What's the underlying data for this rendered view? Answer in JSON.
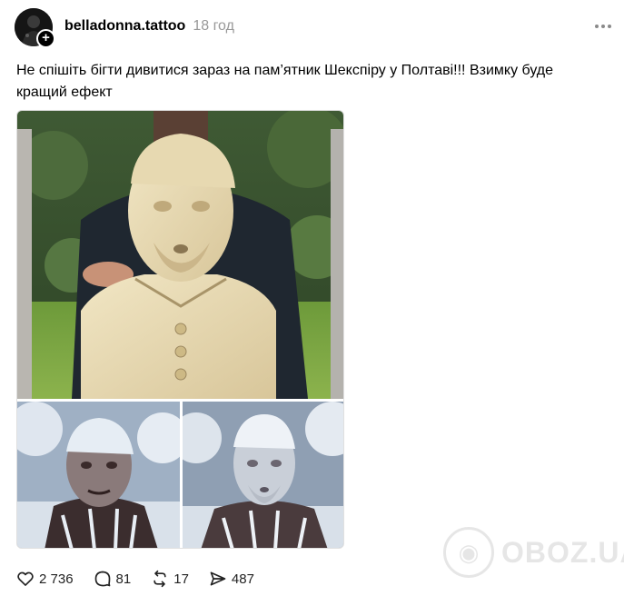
{
  "post": {
    "username": "belladonna.tattoo",
    "time": "18 год",
    "follow_symbol": "+",
    "caption": "Не спішіть бігти дивитися зараз на пам’ятник Шекспіру у Полтаві!!! Взимку буде кращий ефект",
    "more_icon": "three-dots-icon"
  },
  "media": {
    "images": [
      {
        "name": "shakespeare-monument-photo"
      },
      {
        "name": "frozen-face-still-left"
      },
      {
        "name": "frozen-monument-edit-right"
      }
    ]
  },
  "actions": {
    "likes": "2 736",
    "comments": "81",
    "reposts": "17",
    "shares": "487",
    "icons": [
      "heart-icon",
      "comment-icon",
      "repost-icon",
      "share-icon"
    ]
  },
  "watermark": {
    "text": "OBOZ.UA"
  },
  "colors": {
    "text": "#000000",
    "muted": "#999999",
    "border": "#e0e0e0"
  }
}
